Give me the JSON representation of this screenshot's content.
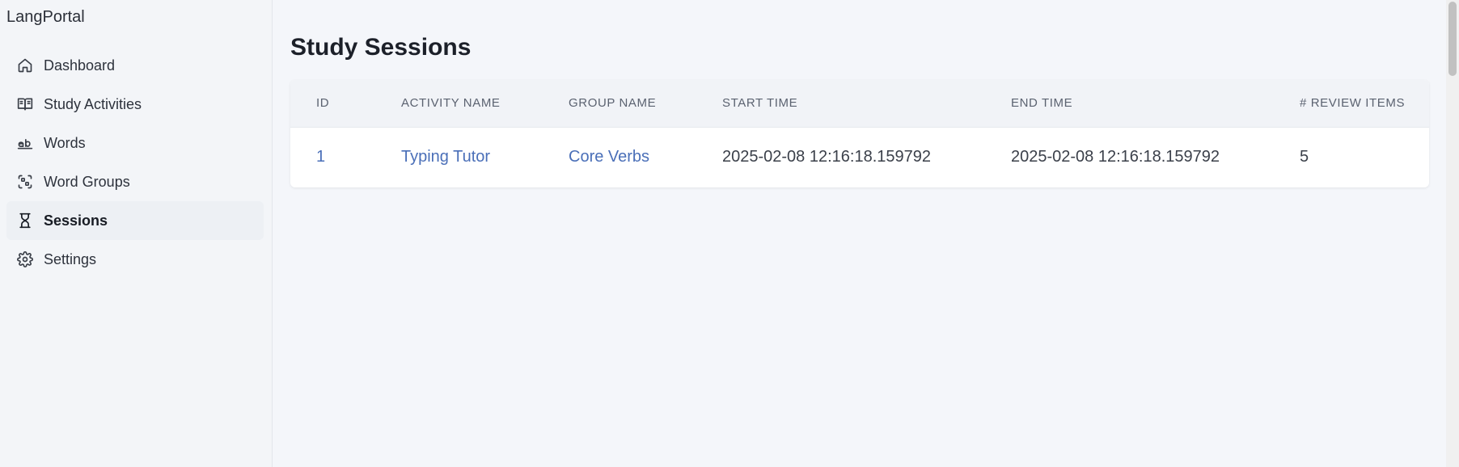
{
  "app": {
    "brand": "LangPortal"
  },
  "sidebar": {
    "items": [
      {
        "label": "Dashboard",
        "icon": "home-icon",
        "active": false
      },
      {
        "label": "Study Activities",
        "icon": "book-open-icon",
        "active": false
      },
      {
        "label": "Words",
        "icon": "text-ab-icon",
        "active": false
      },
      {
        "label": "Word Groups",
        "icon": "group-scan-icon",
        "active": false
      },
      {
        "label": "Sessions",
        "icon": "hourglass-icon",
        "active": true
      },
      {
        "label": "Settings",
        "icon": "gear-icon",
        "active": false
      }
    ]
  },
  "main": {
    "title": "Study Sessions",
    "table": {
      "columns": [
        "ID",
        "ACTIVITY NAME",
        "GROUP NAME",
        "START TIME",
        "END TIME",
        "# REVIEW ITEMS"
      ],
      "rows": [
        {
          "id": "1",
          "activity_name": "Typing Tutor",
          "group_name": "Core Verbs",
          "start_time": "2025-02-08 12:16:18.159792",
          "end_time": "2025-02-08 12:16:18.159792",
          "review_items": "5"
        }
      ]
    }
  },
  "colors": {
    "link": "#4a6fb8",
    "sidebar_bg": "#f3f5f8",
    "main_bg": "#f4f6fa",
    "header_bg": "#f1f3f7"
  }
}
